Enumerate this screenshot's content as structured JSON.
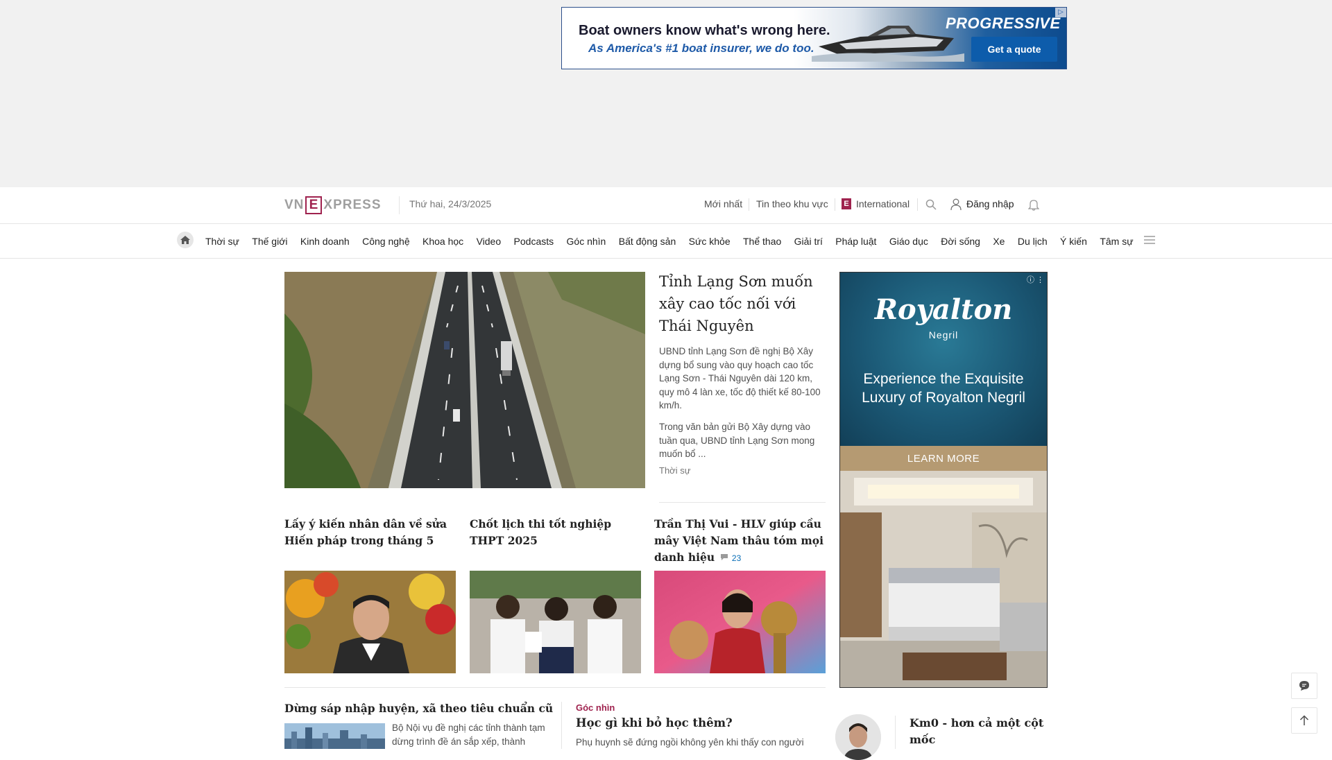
{
  "top_ad": {
    "headline": "Boat owners know what's wrong here.",
    "subline": "As America's #1 boat insurer, we do too.",
    "brand": "PROGRESSIVE",
    "cta": "Get a quote"
  },
  "header": {
    "logo_left": "VN",
    "logo_e": "E",
    "logo_right": "XPRESS",
    "date": "Thứ hai, 24/3/2025",
    "links": {
      "latest": "Mới nhất",
      "regional": "Tin theo khu vực",
      "international": "International"
    },
    "login": "Đăng nhập"
  },
  "nav": {
    "items": [
      "Thời sự",
      "Thế giới",
      "Kinh doanh",
      "Công nghệ",
      "Khoa học",
      "Video",
      "Podcasts",
      "Góc nhìn",
      "Bất động sản",
      "Sức khỏe",
      "Thể thao",
      "Giải trí",
      "Pháp luật",
      "Giáo dục",
      "Đời sống",
      "Xe",
      "Du lịch",
      "Ý kiến",
      "Tâm sự"
    ]
  },
  "featured": {
    "title": "Tỉnh Lạng Sơn muốn xây cao tốc nối với Thái Nguyên",
    "description": "UBND tỉnh Lạng Sơn đề nghị Bộ Xây dựng bổ sung vào quy hoạch cao tốc Lạng Sơn - Thái Nguyên dài 120 km, quy mô 4 làn xe, tốc độ thiết kế 80-100 km/h.",
    "excerpt": "Trong văn bản gửi Bộ Xây dựng vào tuần qua, UBND tỉnh Lạng Sơn mong muốn bổ ...",
    "category": "Thời sự"
  },
  "sub_articles": [
    {
      "title": "Lấy ý kiến nhân dân về sửa Hiến pháp trong tháng 5"
    },
    {
      "title": "Chốt lịch thi tốt nghiệp THPT 2025"
    },
    {
      "title": "Trần Thị Vui - HLV giúp cầu mây Việt Nam thâu tóm mọi danh hiệu",
      "comments": "23"
    }
  ],
  "bottom": {
    "article1": {
      "title": "Dừng sáp nhập huyện, xã theo tiêu chuẩn cũ",
      "description": "Bộ Nội vụ đề nghị các tỉnh thành tạm dừng trình đề án sắp xếp, thành"
    },
    "article2": {
      "label": "Góc nhìn",
      "title": "Học gì khi bỏ học thêm?",
      "description": "Phụ huynh sẽ đứng ngồi không yên khi thấy con người"
    }
  },
  "right_ad": {
    "logo": "Royalton",
    "location": "Negril",
    "tagline": "Experience the Exquisite Luxury of Royalton Negril",
    "cta": "LEARN MORE"
  },
  "opinion": {
    "title": "Km0 - hơn cả một cột mốc"
  },
  "colors": {
    "brand": "#9f224e",
    "link_blue": "#076db6",
    "ad_background": "#f1f1f1"
  }
}
